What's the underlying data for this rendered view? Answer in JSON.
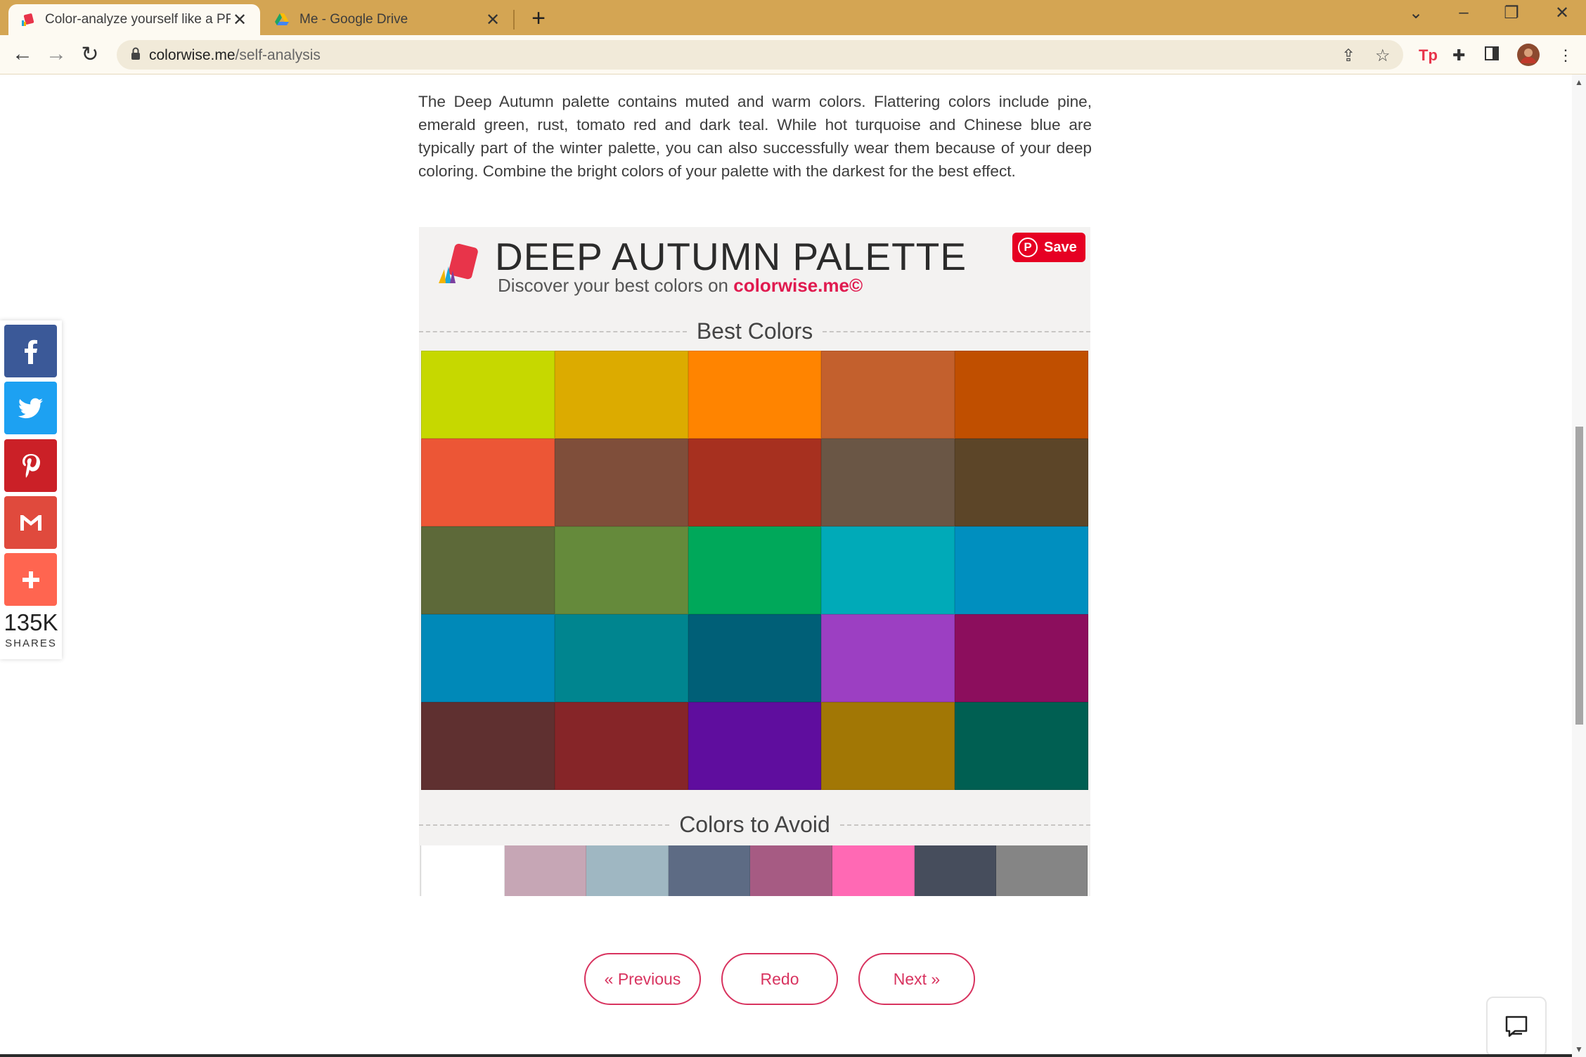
{
  "browser": {
    "tabs": [
      {
        "title": "Color-analyze yourself like a PRO",
        "close": "✕"
      },
      {
        "title": "Me - Google Drive",
        "close": "✕"
      }
    ],
    "new_tab": "+",
    "url_host": "colorwise.me",
    "url_path": "/self-analysis"
  },
  "article": {
    "paragraph": "The Deep Autumn palette contains muted and warm colors. Flattering colors include pine, emerald green, rust, tomato red and dark teal. While hot turquoise and Chinese blue are typically part of the winter palette, you can also successfully wear them because of your deep coloring. Combine the bright colors of your palette with the darkest for the best effect."
  },
  "palette": {
    "title": "DEEP AUTUMN PALETTE",
    "subtitle": "Discover your best colors on ",
    "brand": "colorwise.me",
    "copyright": "©",
    "save_label": "Save",
    "best_label": "Best Colors",
    "avoid_label": "Colors to Avoid",
    "best_colors": [
      "#c6d800",
      "#dcab00",
      "#ff8400",
      "#c3602d",
      "#c04f00",
      "#ec5636",
      "#7f4e3a",
      "#a7301f",
      "#6a5645",
      "#5c4528",
      "#5d6939",
      "#658a3b",
      "#00a85a",
      "#00aab8",
      "#008fbf",
      "#0089b8",
      "#00858f",
      "#005f77",
      "#9c3fc2",
      "#8c0e5d",
      "#5f3030",
      "#862528",
      "#5f0d9e",
      "#a27705",
      "#005f52"
    ],
    "avoid_colors": [
      "#ffffff",
      "#c6a6b5",
      "#9fb7c2",
      "#5d6b84",
      "#a65b83",
      "#ff69b4",
      "#464d5c",
      "#858585"
    ]
  },
  "pagination": {
    "previous": "« Previous",
    "redo": "Redo",
    "next": "Next »"
  },
  "share": {
    "count": "135K",
    "label": "SHARES",
    "colors": {
      "facebook": "#3b5998",
      "twitter": "#1da1f2",
      "pinterest": "#cb2027",
      "gmail": "#e04a3d",
      "more": "#ff6550"
    }
  }
}
